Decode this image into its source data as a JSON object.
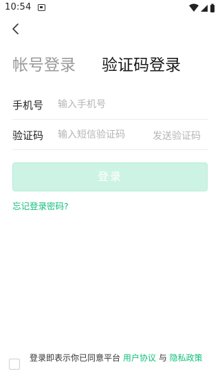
{
  "status_bar": {
    "time": "10:54"
  },
  "nav": {
    "back_icon": "chevron-left-icon"
  },
  "tabs": [
    {
      "label": "帐号登录",
      "active": false
    },
    {
      "label": "验证码登录",
      "active": true
    }
  ],
  "form": {
    "phone_label": "手机号",
    "phone_placeholder": "输入手机号",
    "code_label": "验证码",
    "code_placeholder": "输入短信验证码",
    "send_code_label": "发送验证码"
  },
  "login_button_label": "登录",
  "forgot_password_label": "忘记登录密码?",
  "agreement": {
    "prefix": "登录即表示你已同意平台",
    "user_agreement": "用户协议",
    "conjunction": "与",
    "privacy_policy": "隐私政策",
    "checked": false
  },
  "colors": {
    "accent": "#11c07a",
    "button_disabled_bg": "#ccf3e4",
    "placeholder": "#b5b5b5",
    "inactive_tab": "#9a9a9a"
  }
}
